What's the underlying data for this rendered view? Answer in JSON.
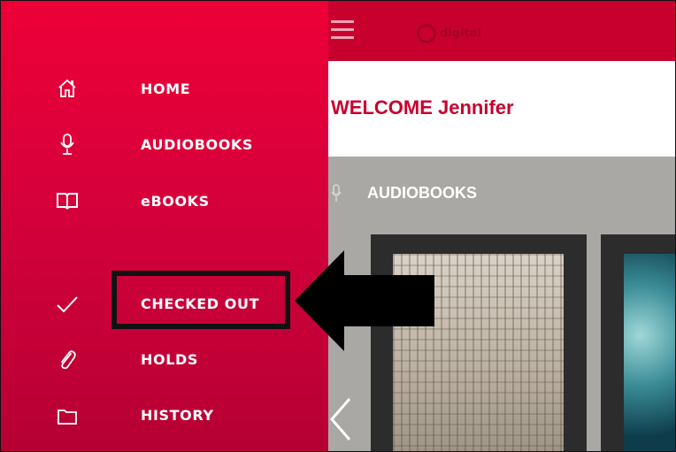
{
  "app": {
    "logo_text": "digital",
    "welcome": "WELCOME Jennifer",
    "accent_color": "#c8002e"
  },
  "sidebar": {
    "items": [
      {
        "label": "HOME",
        "icon": "home-icon"
      },
      {
        "label": "AUDIOBOOKS",
        "icon": "microphone-icon"
      },
      {
        "label": "eBOOKS",
        "icon": "open-book-icon"
      },
      {
        "label": "CHECKED OUT",
        "icon": "checkmark-icon"
      },
      {
        "label": "HOLDS",
        "icon": "paperclip-icon"
      },
      {
        "label": "HISTORY",
        "icon": "folder-icon"
      }
    ]
  },
  "main": {
    "section_title": "AUDIOBOOKS",
    "section_icon": "microphone-icon"
  },
  "annotation": {
    "highlighted_item": "CHECKED OUT",
    "arrow": "pointer-arrow"
  }
}
